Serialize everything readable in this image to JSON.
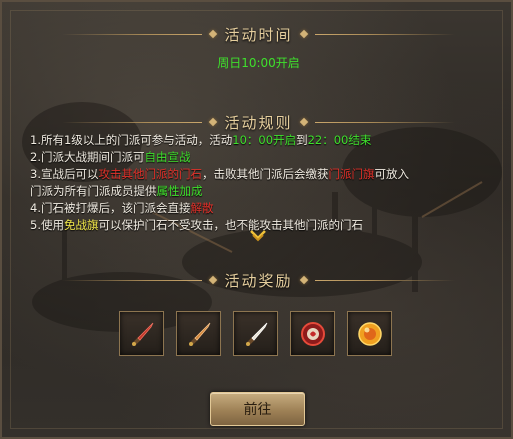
{
  "sections": {
    "time": {
      "title": "活动时间",
      "text": "周日10:00开启"
    },
    "rules": {
      "title": "活动规则",
      "lines": [
        {
          "parts": [
            {
              "text": "1.所有1级以上的门派可参与活动，活动",
              "color": "normal"
            },
            {
              "text": "10：00开启",
              "color": "green"
            },
            {
              "text": "到",
              "color": "normal"
            },
            {
              "text": "22：00结束",
              "color": "green"
            }
          ]
        },
        {
          "parts": [
            {
              "text": "2.门派大战期间门派可",
              "color": "normal"
            },
            {
              "text": "自由宣战",
              "color": "green"
            }
          ]
        },
        {
          "parts": [
            {
              "text": "3.宣战后可以",
              "color": "normal"
            },
            {
              "text": "攻击其他门派的门石",
              "color": "red"
            },
            {
              "text": "，击败其他门派后会缴获",
              "color": "normal"
            },
            {
              "text": "门派门旗",
              "color": "red"
            },
            {
              "text": "可放入",
              "color": "normal"
            }
          ]
        },
        {
          "parts": [
            {
              "text": "门派为所有门派成员提供",
              "color": "normal"
            },
            {
              "text": "属性加成",
              "color": "green"
            }
          ]
        },
        {
          "parts": [
            {
              "text": "4.门石被打爆后，该门派会直接",
              "color": "normal"
            },
            {
              "text": "解散",
              "color": "red"
            }
          ]
        },
        {
          "parts": [
            {
              "text": "5.使用",
              "color": "normal"
            },
            {
              "text": "免战旗",
              "color": "yellow"
            },
            {
              "text": "可以保护门石不受攻击，也不能攻击其他门派的门石",
              "color": "normal"
            }
          ]
        }
      ]
    },
    "rewards": {
      "title": "活动奖励",
      "items": [
        {
          "icon": "red-sword-icon",
          "color": "#c0392b"
        },
        {
          "icon": "orange-sword-icon",
          "color": "#d3873a"
        },
        {
          "icon": "white-sword-icon",
          "color": "#e8e2d2"
        },
        {
          "icon": "red-emblem-icon",
          "color": "#c42a2a"
        },
        {
          "icon": "golden-orb-icon",
          "color": "#f0a020"
        }
      ]
    }
  },
  "go_button": {
    "label": "前往"
  },
  "colors": {
    "green": "#3ee02c",
    "red": "#e0312a",
    "yellow": "#f2e84a",
    "normal": "#f1ece2"
  }
}
